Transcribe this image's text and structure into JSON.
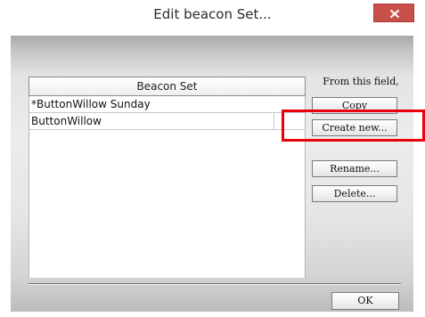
{
  "window": {
    "title": "Edit beacon Set..."
  },
  "list": {
    "header": "Beacon Set",
    "items": [
      "*ButtonWillow Sunday",
      "ButtonWillow"
    ]
  },
  "actions": {
    "field_label": "From this field,",
    "copy_label": "Copy",
    "create_new_label": "Create new...",
    "rename_label": "Rename...",
    "delete_label": "Delete...",
    "ok_label": "OK"
  },
  "icons": {
    "close": "close-icon"
  },
  "colors": {
    "close_button": "#c7504b",
    "highlight": "#e8000b"
  }
}
